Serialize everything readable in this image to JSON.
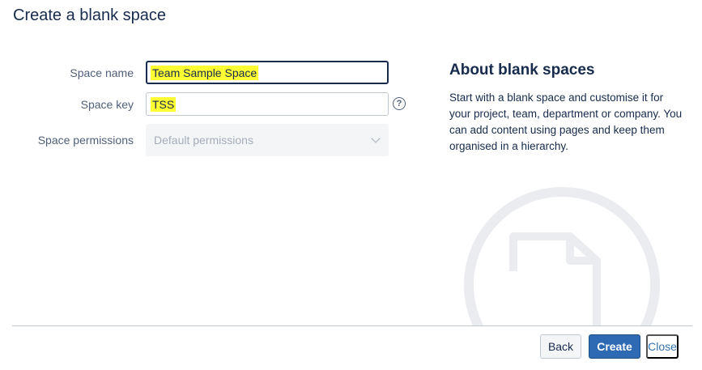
{
  "dialog": {
    "title": "Create a blank space"
  },
  "form": {
    "space_name": {
      "label": "Space name",
      "value": "Team Sample Space"
    },
    "space_key": {
      "label": "Space key",
      "value": "TSS",
      "help_icon": "question-circle-icon"
    },
    "space_permissions": {
      "label": "Space permissions",
      "selected": "Default permissions",
      "disabled": true
    }
  },
  "about": {
    "title": "About blank spaces",
    "description": "Start with a blank space and customise it for your project, team, department or company. You can add content using pages and keep them organised in a hierarchy.",
    "illustration_icon": "blank-page-icon"
  },
  "footer": {
    "back_label": "Back",
    "create_label": "Create",
    "close_label": "Close"
  },
  "colors": {
    "primary_button": "#2d6ab3",
    "link": "#3572b0",
    "highlight": "#ffff33"
  }
}
